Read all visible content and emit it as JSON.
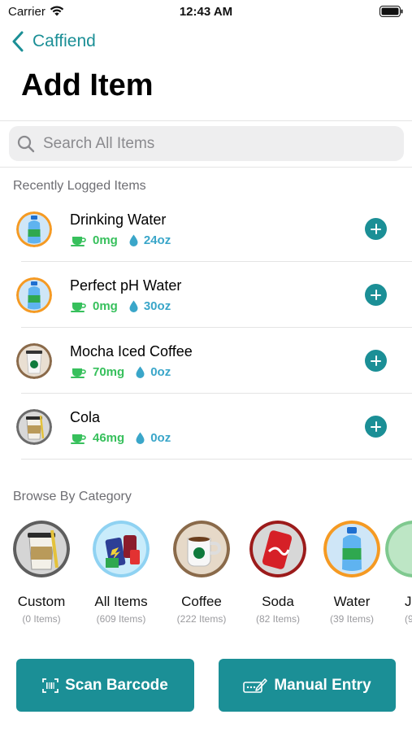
{
  "status_bar": {
    "carrier": "Carrier",
    "time": "12:43 AM"
  },
  "nav": {
    "back_label": "Caffiend"
  },
  "page": {
    "title": "Add Item"
  },
  "search": {
    "placeholder": "Search All Items"
  },
  "recent": {
    "header": "Recently Logged Items",
    "items": [
      {
        "name": "Drinking Water",
        "caffeine": "0mg",
        "volume": "24oz",
        "icon": "water-bottle-icon"
      },
      {
        "name": "Perfect pH Water",
        "caffeine": "0mg",
        "volume": "30oz",
        "icon": "water-bottle-icon"
      },
      {
        "name": "Mocha Iced Coffee",
        "caffeine": "70mg",
        "volume": "0oz",
        "icon": "coffee-cup-icon"
      },
      {
        "name": "Cola",
        "caffeine": "46mg",
        "volume": "0oz",
        "icon": "custom-cup-icon"
      }
    ]
  },
  "categories": {
    "header": "Browse By Category",
    "items": [
      {
        "name": "Custom",
        "count": "(0 Items)",
        "icon": "custom-cup-icon"
      },
      {
        "name": "All Items",
        "count": "(609 Items)",
        "icon": "all-items-icon"
      },
      {
        "name": "Coffee",
        "count": "(222 Items)",
        "icon": "coffee-mug-icon"
      },
      {
        "name": "Soda",
        "count": "(82 Items)",
        "icon": "soda-can-icon"
      },
      {
        "name": "Water",
        "count": "(39 Items)",
        "icon": "water-bottle-icon"
      },
      {
        "name": "J",
        "count": "(9",
        "icon": "juice-icon"
      }
    ]
  },
  "actions": {
    "scan_label": "Scan Barcode",
    "manual_label": "Manual Entry"
  },
  "colors": {
    "accent": "#1b8f96",
    "caffeine": "#37c05c",
    "volume": "#3aa6c9"
  }
}
